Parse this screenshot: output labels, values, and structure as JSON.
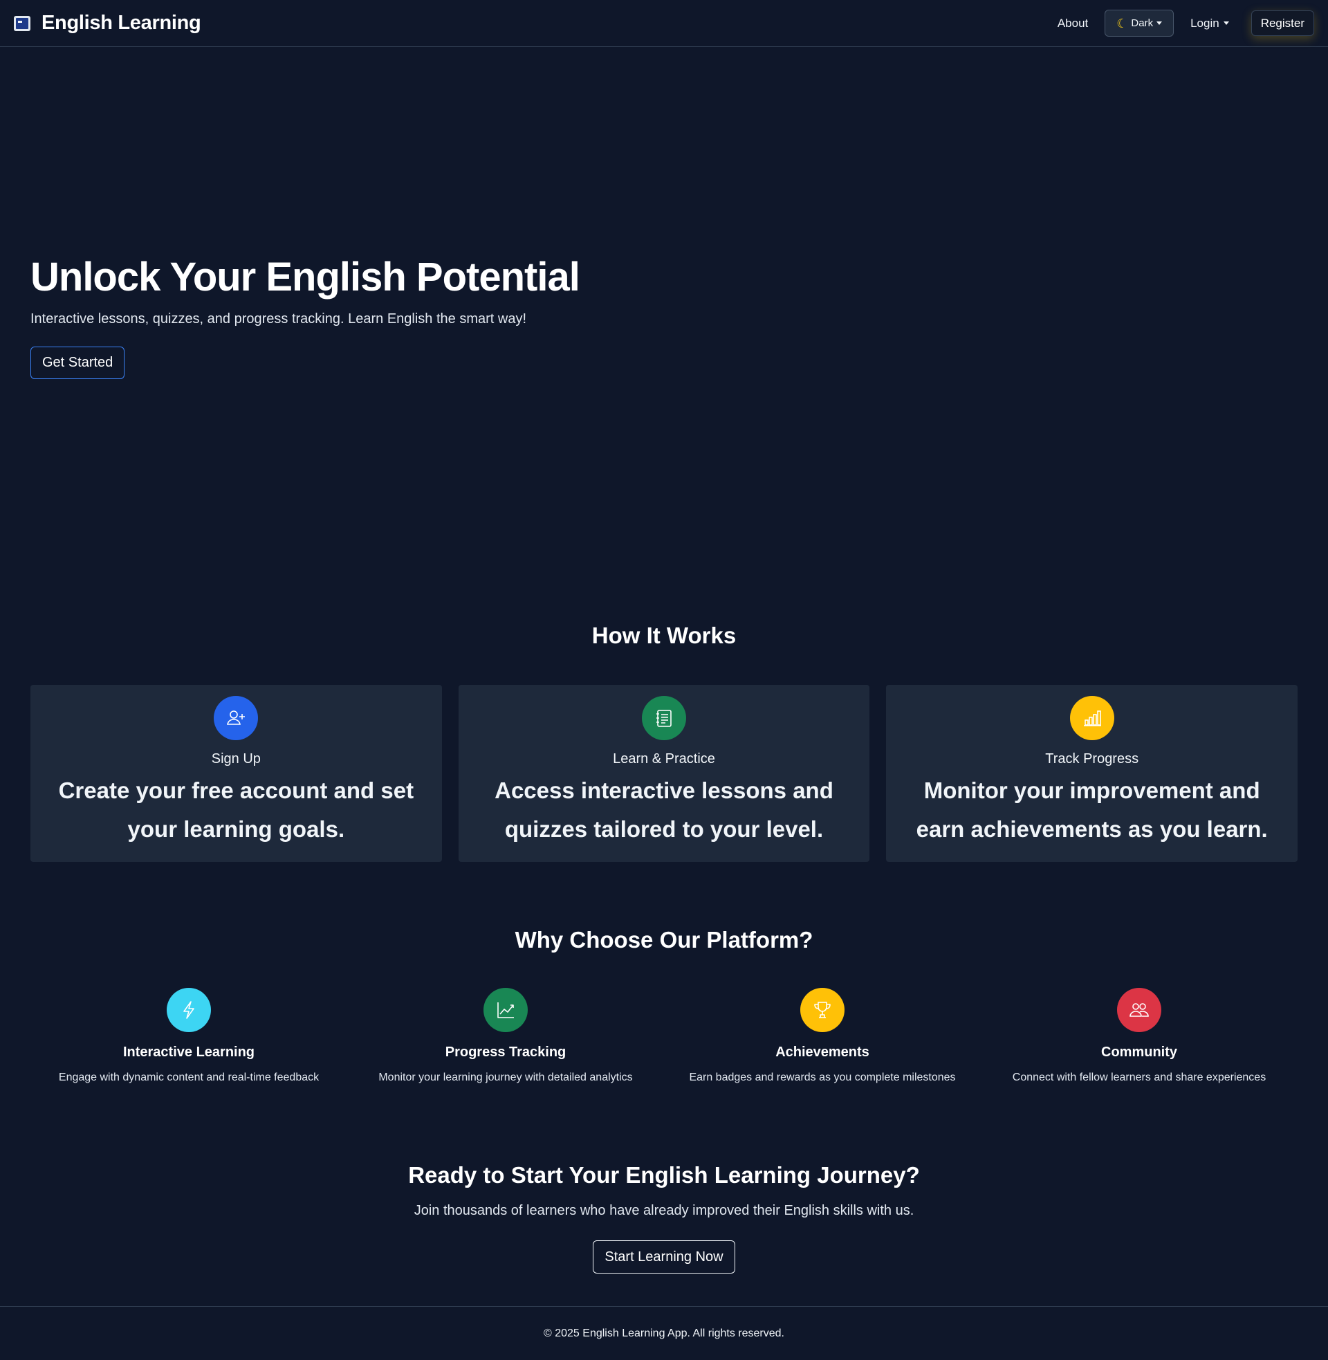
{
  "navbar": {
    "brand": "English Learning",
    "about": "About",
    "theme": "Dark",
    "login": "Login",
    "register": "Register"
  },
  "hero": {
    "title": "Unlock Your English Potential",
    "subtitle": "Interactive lessons, quizzes, and progress tracking. Learn English the smart way!",
    "cta": "Get Started"
  },
  "how_it_works": {
    "title": "How It Works",
    "steps": [
      {
        "label": "Sign Up",
        "description": "Create your free account and set your learning goals.",
        "icon": "user-plus-icon",
        "color": "#2563eb"
      },
      {
        "label": "Learn & Practice",
        "description": "Access interactive lessons and quizzes tailored to your level.",
        "icon": "journal-icon",
        "color": "#198754"
      },
      {
        "label": "Track Progress",
        "description": "Monitor your improvement and earn achievements as you learn.",
        "icon": "bar-chart-icon",
        "color": "#ffc107"
      }
    ]
  },
  "why_choose": {
    "title": "Why Choose Our Platform?",
    "features": [
      {
        "title": "Interactive Learning",
        "description": "Engage with dynamic content and real-time feedback",
        "icon": "lightning-icon",
        "color": "#3dd5f3"
      },
      {
        "title": "Progress Tracking",
        "description": "Monitor your learning journey with detailed analytics",
        "icon": "graph-up-icon",
        "color": "#198754"
      },
      {
        "title": "Achievements",
        "description": "Earn badges and rewards as you complete milestones",
        "icon": "trophy-icon",
        "color": "#ffc107"
      },
      {
        "title": "Community",
        "description": "Connect with fellow learners and share experiences",
        "icon": "people-icon",
        "color": "#dc3545"
      }
    ]
  },
  "cta": {
    "title": "Ready to Start Your English Learning Journey?",
    "subtitle": "Join thousands of learners who have already improved their English skills with us.",
    "button": "Start Learning Now"
  },
  "footer": {
    "text": "© 2025 English Learning App. All rights reserved."
  }
}
